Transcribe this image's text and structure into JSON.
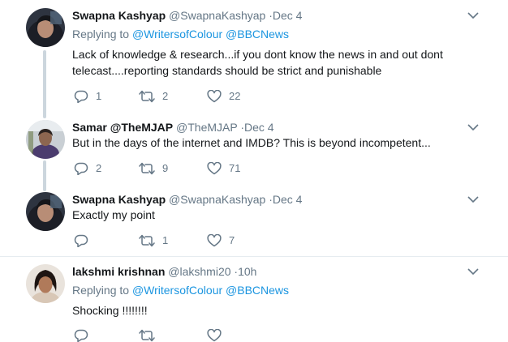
{
  "tweets": [
    {
      "name": "Swapna Kashyap",
      "handle": "@SwapnaKashyap",
      "time": "·Dec 4",
      "replying_prefix": "Replying to",
      "mentions": [
        "@WritersofColour",
        "@BBCNews"
      ],
      "text": "Lack of knowledge & research...if you dont know the news in and out dont telecast....reporting standards should be strict and punishable",
      "replies": "1",
      "retweets": "2",
      "likes": "22"
    },
    {
      "name": "Samar @TheMJAP",
      "handle": "@TheMJAP",
      "time": "·Dec 4",
      "text": "But in the days of the internet and IMDB? This is beyond incompetent...",
      "replies": "2",
      "retweets": "9",
      "likes": "71"
    },
    {
      "name": "Swapna Kashyap",
      "handle": "@SwapnaKashyap",
      "time": "·Dec 4",
      "text": "Exactly my point",
      "replies": "",
      "retweets": "1",
      "likes": "7"
    },
    {
      "name": "lakshmi krishnan",
      "handle": "@lakshmi20",
      "time": "·10h",
      "replying_prefix": "Replying to",
      "mentions": [
        "@WritersofColour",
        "@BBCNews"
      ],
      "text": "Shocking !!!!!!!!",
      "replies": "",
      "retweets": "",
      "likes": ""
    }
  ],
  "icons": {
    "reply": "reply-icon",
    "retweet": "retweet-icon",
    "like": "heart-icon",
    "menu": "chevron-down-icon"
  },
  "colors": {
    "text": "#14171a",
    "muted": "#657786",
    "link": "#1b95e0",
    "thread_line": "#ccd6dd"
  }
}
